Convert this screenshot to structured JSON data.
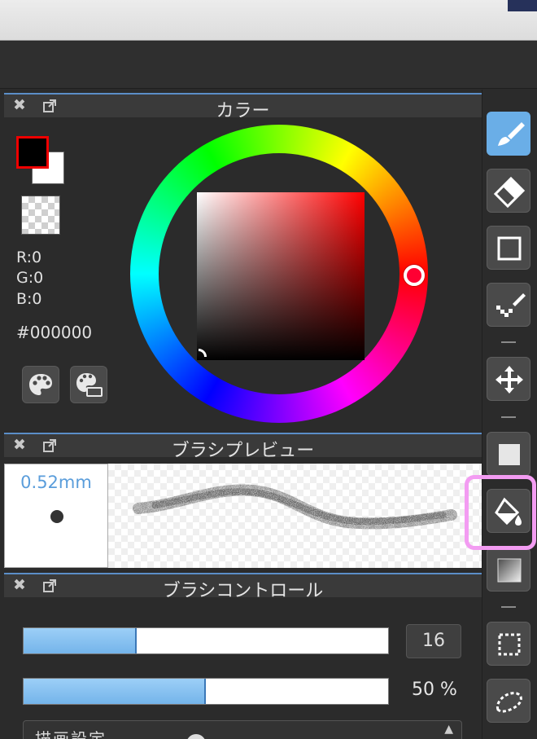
{
  "color_panel": {
    "title": "カラー",
    "r_label": "R:0",
    "g_label": "G:0",
    "b_label": "B:0",
    "hex": "#000000",
    "foreground_color": "#000000",
    "background_color": "#ffffff"
  },
  "preview_panel": {
    "title": "ブラシプレビュー",
    "brush_size": "0.52mm"
  },
  "control_panel": {
    "title": "ブラシコントロール",
    "size_value": "16",
    "size_fraction": 0.31,
    "opacity_label": "50 %",
    "opacity_fraction": 0.5,
    "dropdown_text": "描画設定"
  },
  "colors": {
    "accent": "#5b8ec8",
    "active_tool": "#6aaee7",
    "highlight": "#f39cf2",
    "slider_fill": "#8cc5f3"
  },
  "toolbar": {
    "tools": [
      "brush-tool",
      "eraser-tool",
      "rectangle-tool",
      "dot-brush-tool",
      "move-tool",
      "fill-square-tool",
      "bucket-fill-tool",
      "gradient-tool",
      "rect-select-tool",
      "lasso-tool"
    ],
    "active": "brush-tool",
    "highlighted": "bucket-fill-tool"
  }
}
